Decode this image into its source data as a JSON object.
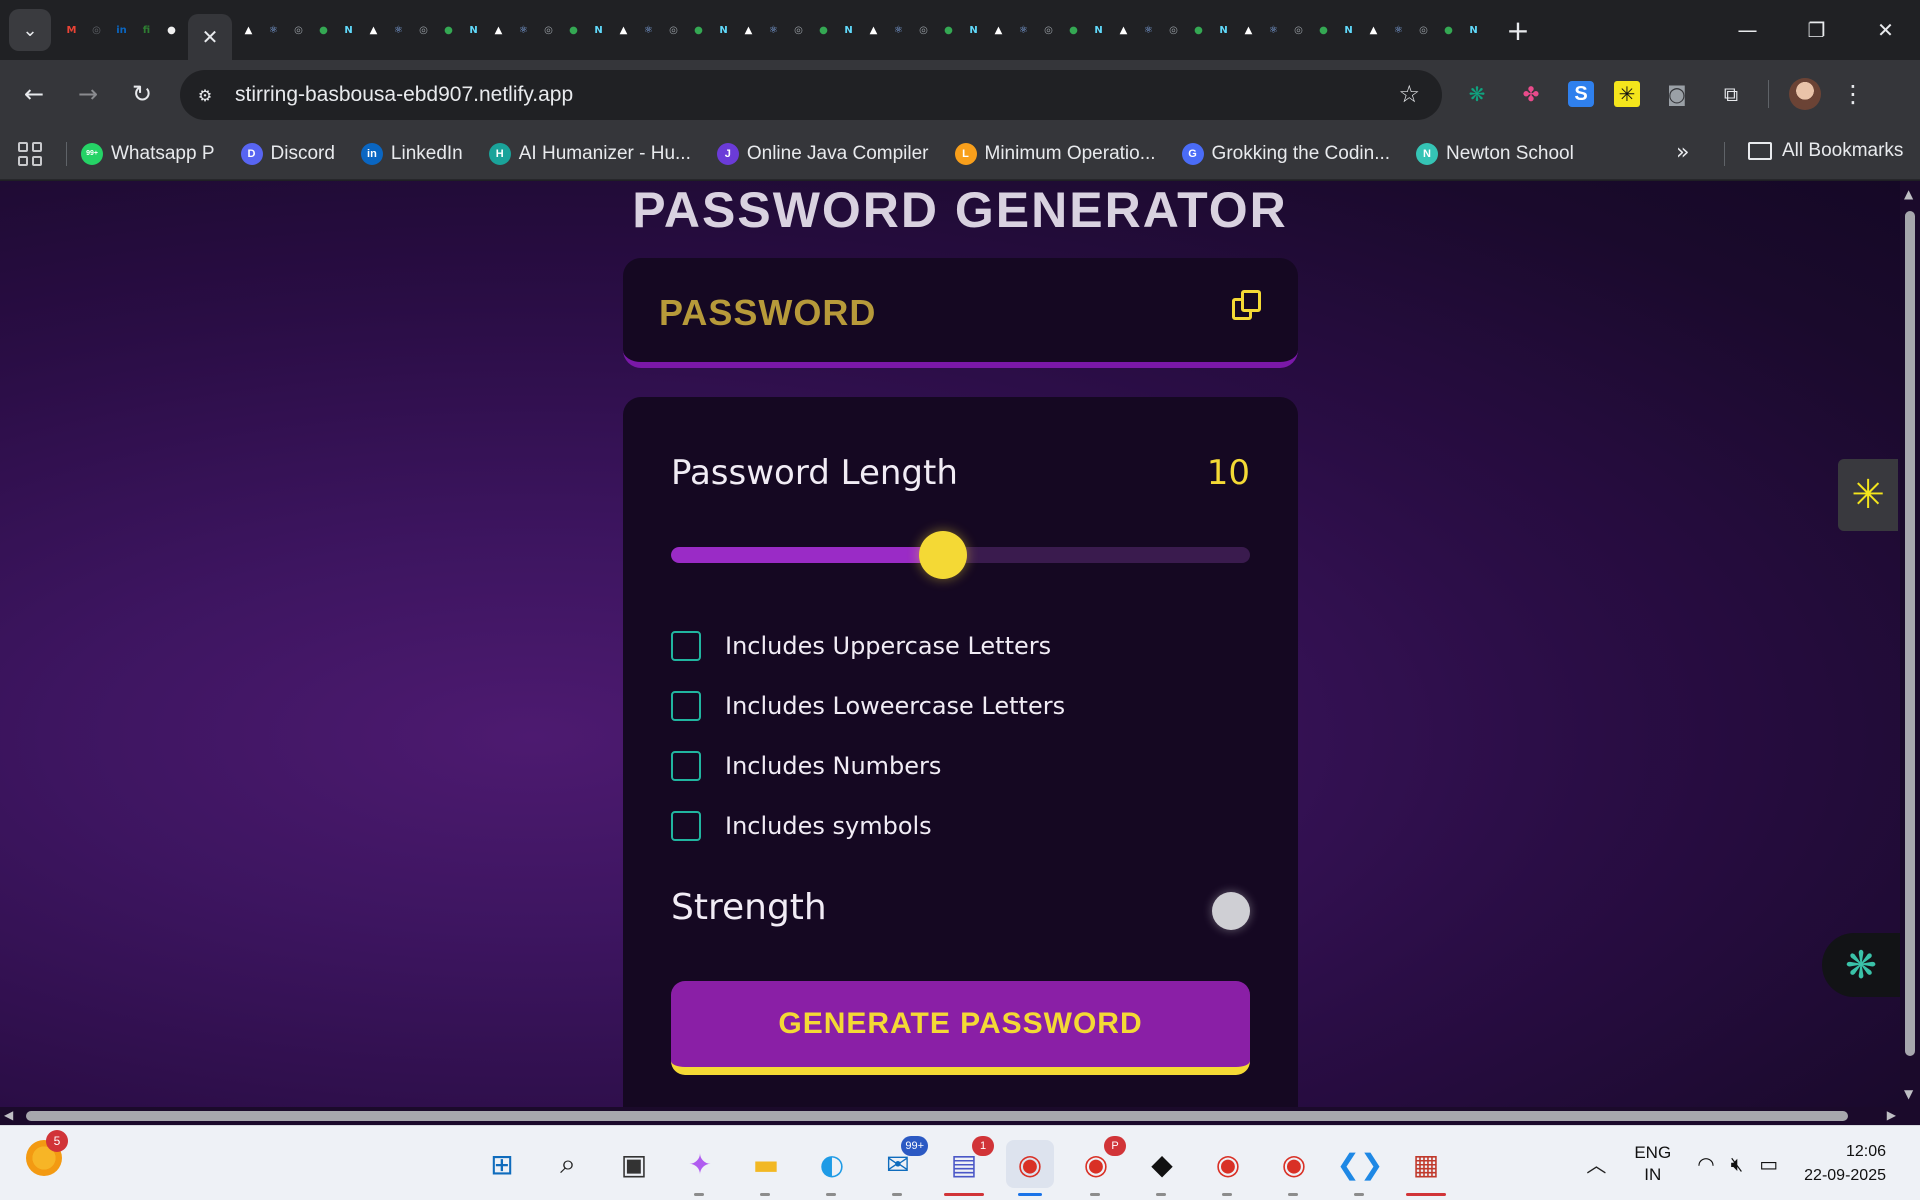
{
  "browser": {
    "tab_close": "✕",
    "new_tab": "+",
    "url": "stirring-basbousa-ebd907.netlify.app",
    "pinned_tabs": [
      {
        "icon": "gmail-icon",
        "glyph": "M",
        "color": "#ea4335"
      },
      {
        "icon": "site-icon",
        "glyph": "◎",
        "color": "#5f6368"
      },
      {
        "icon": "linkedin-icon",
        "glyph": "in",
        "color": "#0a66c2"
      },
      {
        "icon": "fi-icon",
        "glyph": "fi",
        "color": "#2e7d32"
      },
      {
        "icon": "github-icon",
        "glyph": "●",
        "color": "#f0f0f0"
      }
    ],
    "other_tabs_count": 50,
    "window_controls": {
      "minimize": "—",
      "restore": "❐",
      "close": "✕"
    }
  },
  "bookmarks": [
    {
      "label": "Whatsapp P",
      "icon": "whatsapp-icon",
      "color": "#25d366",
      "glyph": "99+"
    },
    {
      "label": "Discord",
      "icon": "discord-icon",
      "color": "#5865f2",
      "glyph": "D"
    },
    {
      "label": "LinkedIn",
      "icon": "linkedin-icon",
      "color": "#0a66c2",
      "glyph": "in"
    },
    {
      "label": "AI Humanizer - Hu...",
      "icon": "ai-humanizer-icon",
      "color": "#1aa39a",
      "glyph": "H"
    },
    {
      "label": "Online Java Compiler",
      "icon": "java-compiler-icon",
      "color": "#6b3bd8",
      "glyph": "J"
    },
    {
      "label": "Minimum Operatio...",
      "icon": "leetcode-icon",
      "color": "#f89f1b",
      "glyph": "L"
    },
    {
      "label": "Grokking the Codin...",
      "icon": "grokking-icon",
      "color": "#4a6cf7",
      "glyph": "G"
    },
    {
      "label": "Newton School",
      "icon": "newton-school-icon",
      "color": "#35c4b5",
      "glyph": "N"
    }
  ],
  "all_bookmarks": "All Bookmarks",
  "app": {
    "title": "PASSWORD GENERATOR",
    "password_display": "PASSWORD",
    "length_label": "Password Length",
    "length_value": "10",
    "slider_fraction": 0.47,
    "options": [
      {
        "label": "Includes Uppercase Letters",
        "checked": false
      },
      {
        "label": "Includes Loweercase Letters",
        "checked": false
      },
      {
        "label": "Includes Numbers",
        "checked": false
      },
      {
        "label": "Includes symbols",
        "checked": false
      }
    ],
    "strength_label": "Strength",
    "generate_button": "GENERATE PASSWORD"
  },
  "taskbar": {
    "weather_badge": "5",
    "apps": [
      {
        "name": "start-button",
        "glyph": "⊞",
        "color": "#0f6cbd"
      },
      {
        "name": "search-button",
        "glyph": "⌕",
        "color": "#222"
      },
      {
        "name": "task-view-button",
        "glyph": "▣",
        "color": "#333"
      },
      {
        "name": "copilot-app",
        "glyph": "✦",
        "color": "#b05cf0"
      },
      {
        "name": "file-explorer-app",
        "glyph": "▬",
        "color": "#f2b823"
      },
      {
        "name": "edge-app",
        "glyph": "◐",
        "color": "#1e9be6"
      },
      {
        "name": "outlook-app",
        "glyph": "✉",
        "color": "#0f6cbd",
        "badge": "99+"
      },
      {
        "name": "teams-chat-app",
        "glyph": "▤",
        "color": "#4a57c7",
        "badge": "1",
        "badge_red": true,
        "red_run": true
      },
      {
        "name": "chrome-app-1",
        "glyph": "◉",
        "color": "#d93025",
        "active": true
      },
      {
        "name": "chrome-app-2",
        "glyph": "◉",
        "color": "#d93025",
        "badge": "P",
        "badge_red": true
      },
      {
        "name": "cursor-app",
        "glyph": "◆",
        "color": "#111"
      },
      {
        "name": "chrome-app-3",
        "glyph": "◉",
        "color": "#d93025"
      },
      {
        "name": "chrome-app-4",
        "glyph": "◉",
        "color": "#d93025"
      },
      {
        "name": "vscode-app",
        "glyph": "❮❯",
        "color": "#1e88e5"
      },
      {
        "name": "snipping-app",
        "glyph": "▦",
        "color": "#c0392b",
        "red_run": true
      }
    ],
    "lang_line1": "ENG",
    "lang_line2": "IN",
    "time": "12:06",
    "date": "22-09-2025"
  }
}
